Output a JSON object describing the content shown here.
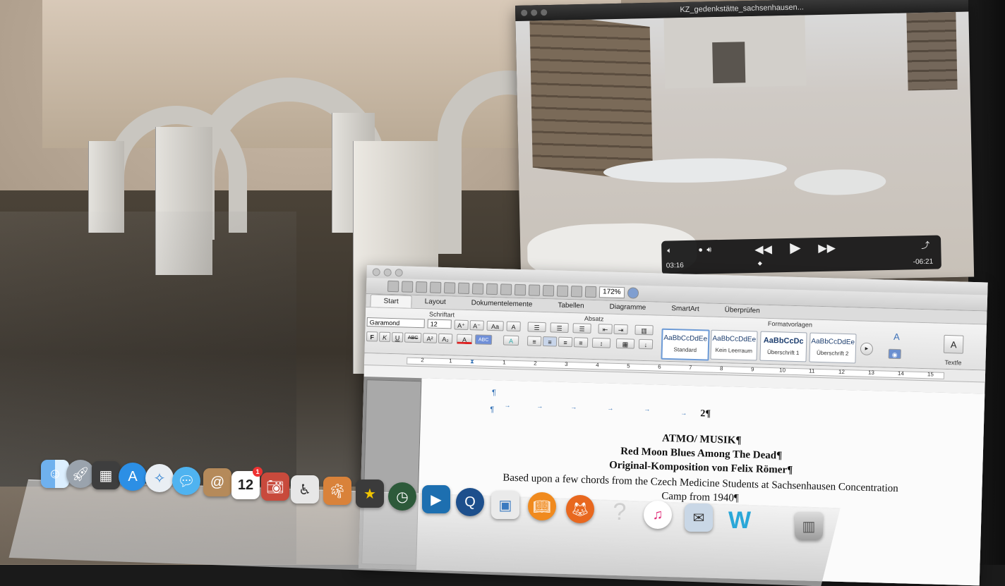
{
  "video": {
    "window_title": "KZ_gedenkstätte_sachsenhausen...",
    "current_time": "03:16",
    "remaining_time": "-06:21"
  },
  "word": {
    "zoom": "172%",
    "tabs": [
      "Start",
      "Layout",
      "Dokumentelemente",
      "Tabellen",
      "Diagramme",
      "SmartArt",
      "Überprüfen"
    ],
    "group_labels": {
      "font": "Schriftart",
      "paragraph": "Absatz",
      "styles": "Formatvorlagen",
      "textfield": "Textfe"
    },
    "font_name": "Garamond",
    "font_size": "12",
    "styles": [
      {
        "sample": "AaBbCcDdEe",
        "name": "Standard"
      },
      {
        "sample": "AaBbCcDdEe",
        "name": "Kein Leerraum"
      },
      {
        "sample": "AaBbCcDc",
        "name": "Überschrift 1"
      },
      {
        "sample": "AaBbCcDdEe",
        "name": "Überschrift 2"
      }
    ],
    "ruler_numbers": [
      "2",
      "1",
      "1",
      "2",
      "3",
      "4",
      "5",
      "6",
      "7",
      "8",
      "9",
      "10",
      "11",
      "12",
      "13",
      "14",
      "15"
    ],
    "document": {
      "page_number": "2¶",
      "pilcrow": "¶",
      "heading": "ATMO/ MUSIK¶",
      "title": "Red Moon Blues Among The Dead¶",
      "subtitle": "Original-Komposition von Felix Römer¶",
      "line1": "Based upon a few chords from the Czech Medicine Students at Sachsenhausen Concentration",
      "line2": "Camp from 1940¶"
    }
  },
  "dock": {
    "calendar_day": "12",
    "calendar_badge": "1",
    "icons": [
      "finder-icon",
      "launchpad-icon",
      "mission-control-icon",
      "app-store-icon",
      "safari-icon",
      "messages-icon",
      "contacts-icon",
      "calendar-icon",
      "photo-booth-icon",
      "accessibility-icon",
      "iphoto-icon",
      "imovie-icon",
      "time-machine-icon",
      "final-cut-icon",
      "quicktime-icon",
      "preview-icon",
      "ibooks-icon",
      "firefox-icon",
      "unknown-app-icon",
      "itunes-icon",
      "mail-stamp-icon",
      "word-icon",
      "trash-icon"
    ]
  }
}
